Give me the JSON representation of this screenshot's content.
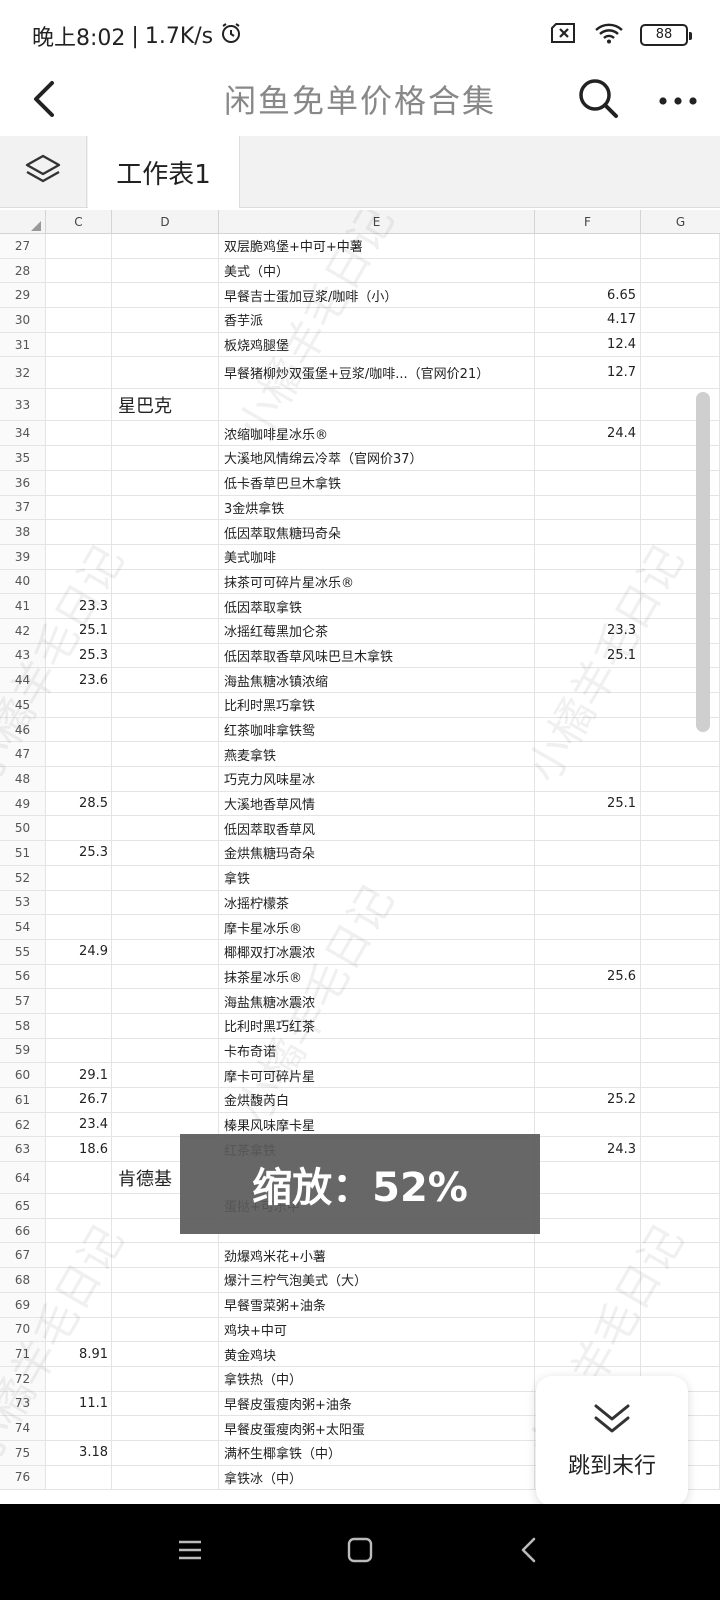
{
  "status": {
    "time": "晚上8:02",
    "separator": "|",
    "speed": "1.7K/s",
    "battery": "88"
  },
  "header": {
    "title": "闲鱼免单价格合集"
  },
  "sheet_tab": {
    "label": "工作表1"
  },
  "columns": [
    "C",
    "D",
    "E",
    "F",
    "G"
  ],
  "rows": [
    {
      "n": "27",
      "c": "",
      "d": "",
      "e": "双层脆鸡堡+中可+中薯",
      "f": ""
    },
    {
      "n": "28",
      "c": "",
      "d": "",
      "e": "美式（中）",
      "f": ""
    },
    {
      "n": "29",
      "c": "",
      "d": "",
      "e": "早餐吉士蛋加豆浆/咖啡（小）",
      "f": "6.65"
    },
    {
      "n": "30",
      "c": "",
      "d": "",
      "e": "香芋派",
      "f": "4.17"
    },
    {
      "n": "31",
      "c": "",
      "d": "",
      "e": "板烧鸡腿堡",
      "f": "12.4"
    },
    {
      "n": "32",
      "c": "",
      "d": "",
      "e": "早餐猪柳炒双蛋堡+豆浆/咖啡...（官网价21）",
      "f": "12.7",
      "tall": true
    },
    {
      "n": "33",
      "c": "",
      "d": "星巴克",
      "e": "",
      "f": "",
      "tall": true
    },
    {
      "n": "34",
      "c": "",
      "d": "",
      "e": "浓缩咖啡星冰乐®",
      "f": "24.4"
    },
    {
      "n": "35",
      "c": "",
      "d": "",
      "e": "大溪地风情绵云冷萃（官网价37）",
      "f": ""
    },
    {
      "n": "36",
      "c": "",
      "d": "",
      "e": "低卡香草巴旦木拿铁",
      "f": ""
    },
    {
      "n": "37",
      "c": "",
      "d": "",
      "e": "3金烘拿铁",
      "f": ""
    },
    {
      "n": "38",
      "c": "",
      "d": "",
      "e": "低因萃取焦糖玛奇朵",
      "f": ""
    },
    {
      "n": "39",
      "c": "",
      "d": "",
      "e": "美式咖啡",
      "f": ""
    },
    {
      "n": "40",
      "c": "",
      "d": "",
      "e": "抹茶可可碎片星冰乐®",
      "f": ""
    },
    {
      "n": "41",
      "c": "23.3",
      "d": "",
      "e": "低因萃取拿铁",
      "f": ""
    },
    {
      "n": "42",
      "c": "25.1",
      "d": "",
      "e": "冰摇红莓黑加仑茶",
      "f": "23.3"
    },
    {
      "n": "43",
      "c": "25.3",
      "d": "",
      "e": "低因萃取香草风味巴旦木拿铁",
      "f": "25.1"
    },
    {
      "n": "44",
      "c": "23.6",
      "d": "",
      "e": "海盐焦糖冰镇浓缩",
      "f": ""
    },
    {
      "n": "45",
      "c": "",
      "d": "",
      "e": "比利时黑巧拿铁",
      "f": ""
    },
    {
      "n": "46",
      "c": "",
      "d": "",
      "e": "红茶咖啡拿铁鸳",
      "f": ""
    },
    {
      "n": "47",
      "c": "",
      "d": "",
      "e": "燕麦拿铁",
      "f": ""
    },
    {
      "n": "48",
      "c": "",
      "d": "",
      "e": "巧克力风味星冰",
      "f": ""
    },
    {
      "n": "49",
      "c": "28.5",
      "d": "",
      "e": "大溪地香草风情",
      "f": "25.1"
    },
    {
      "n": "50",
      "c": "",
      "d": "",
      "e": "低因萃取香草风",
      "f": ""
    },
    {
      "n": "51",
      "c": "25.3",
      "d": "",
      "e": "金烘焦糖玛奇朵",
      "f": ""
    },
    {
      "n": "52",
      "c": "",
      "d": "",
      "e": "拿铁",
      "f": ""
    },
    {
      "n": "53",
      "c": "",
      "d": "",
      "e": "冰摇柠檬茶",
      "f": ""
    },
    {
      "n": "54",
      "c": "",
      "d": "",
      "e": "摩卡星冰乐®",
      "f": ""
    },
    {
      "n": "55",
      "c": "24.9",
      "d": "",
      "e": "椰椰双打冰震浓",
      "f": ""
    },
    {
      "n": "56",
      "c": "",
      "d": "",
      "e": "抹茶星冰乐®",
      "f": "25.6"
    },
    {
      "n": "57",
      "c": "",
      "d": "",
      "e": "海盐焦糖冰震浓",
      "f": ""
    },
    {
      "n": "58",
      "c": "",
      "d": "",
      "e": "比利时黑巧红茶",
      "f": ""
    },
    {
      "n": "59",
      "c": "",
      "d": "",
      "e": "卡布奇诺",
      "f": ""
    },
    {
      "n": "60",
      "c": "29.1",
      "d": "",
      "e": "摩卡可可碎片星",
      "f": ""
    },
    {
      "n": "61",
      "c": "26.7",
      "d": "",
      "e": "金烘馥芮白",
      "f": "25.2"
    },
    {
      "n": "62",
      "c": "23.4",
      "d": "",
      "e": "榛果风味摩卡星",
      "f": ""
    },
    {
      "n": "63",
      "c": "18.6",
      "d": "",
      "e": "红茶拿铁",
      "f": "24.3"
    },
    {
      "n": "64",
      "c": "",
      "d": "肯德基",
      "e": "",
      "f": "",
      "tall": true
    },
    {
      "n": "65",
      "c": "",
      "d": "",
      "e": "蛋挞+可乐中",
      "f": ""
    },
    {
      "n": "66",
      "c": "",
      "d": "",
      "e": "",
      "f": ""
    },
    {
      "n": "67",
      "c": "",
      "d": "",
      "e": "劲爆鸡米花+小薯",
      "f": ""
    },
    {
      "n": "68",
      "c": "",
      "d": "",
      "e": "爆汁三柠气泡美式（大）",
      "f": ""
    },
    {
      "n": "69",
      "c": "",
      "d": "",
      "e": "早餐雪菜粥+油条",
      "f": ""
    },
    {
      "n": "70",
      "c": "",
      "d": "",
      "e": "鸡块+中可",
      "f": ""
    },
    {
      "n": "71",
      "c": "8.91",
      "d": "",
      "e": "黄金鸡块",
      "f": ""
    },
    {
      "n": "72",
      "c": "",
      "d": "",
      "e": "拿铁热（中）",
      "f": ""
    },
    {
      "n": "73",
      "c": "11.1",
      "d": "",
      "e": "早餐皮蛋瘦肉粥+油条",
      "f": ""
    },
    {
      "n": "74",
      "c": "",
      "d": "",
      "e": "早餐皮蛋瘦肉粥+太阳蛋",
      "f": ""
    },
    {
      "n": "75",
      "c": "3.18",
      "d": "",
      "e": "满杯生椰拿铁（中）",
      "f": ""
    },
    {
      "n": "76",
      "c": "",
      "d": "",
      "e": "拿铁冰（中）",
      "f": ""
    }
  ],
  "watermark": "小橘羊毛日记",
  "zoom_toast": {
    "text": "缩放：52%"
  },
  "jump_button": {
    "label": "跳到末行"
  },
  "icons": {
    "back": "back-arrow-icon",
    "search": "search-icon",
    "more": "more-dots-icon",
    "layers": "layers-icon",
    "jump": "double-chevron-down-icon"
  }
}
